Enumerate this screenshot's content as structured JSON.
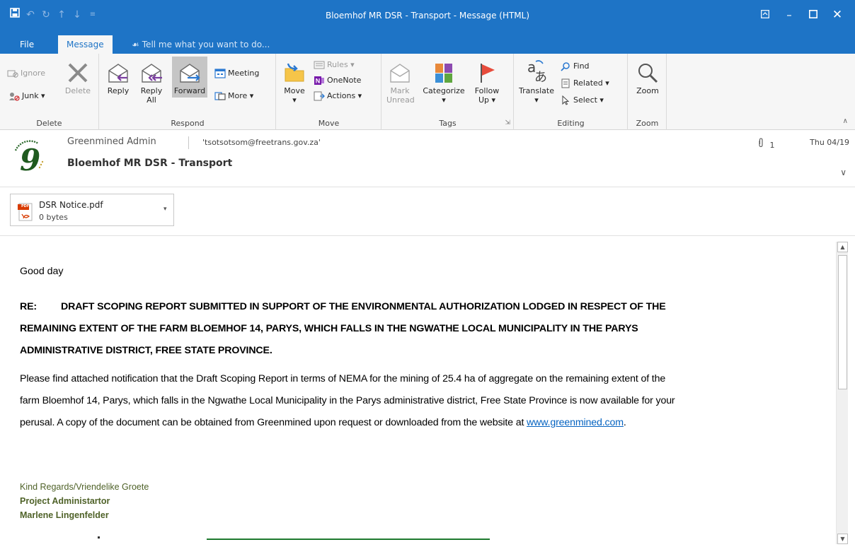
{
  "window": {
    "title": "Bloemhof MR DSR - Transport - Message (HTML)"
  },
  "tabs": {
    "file": "File",
    "message": "Message",
    "tell_me": "Tell me what you want to do..."
  },
  "ribbon": {
    "delete_group": {
      "label": "Delete",
      "ignore": "Ignore",
      "junk": "Junk",
      "delete": "Delete"
    },
    "respond_group": {
      "label": "Respond",
      "reply": "Reply",
      "reply_all_1": "Reply",
      "reply_all_2": "All",
      "forward": "Forward",
      "meeting": "Meeting",
      "more": "More"
    },
    "move_group": {
      "label": "Move",
      "move": "Move",
      "rules": "Rules",
      "onenote": "OneNote",
      "actions": "Actions"
    },
    "tags_group": {
      "label": "Tags",
      "mark_unread_1": "Mark",
      "mark_unread_2": "Unread",
      "categorize": "Categorize",
      "follow_up_1": "Follow",
      "follow_up_2": "Up"
    },
    "editing_group": {
      "label": "Editing",
      "translate": "Translate",
      "find": "Find",
      "related": "Related",
      "select": "Select"
    },
    "zoom_group": {
      "label": "Zoom",
      "zoom": "Zoom"
    }
  },
  "message": {
    "sender": "Greenmined Admin",
    "to": "'tsotsotsom@freetrans.gov.za'",
    "subject": "Bloemhof MR DSR - Transport",
    "attachment_count": "1",
    "date": "Thu 04/19",
    "attachment": {
      "name": "DSR Notice.pdf",
      "size": "0 bytes",
      "type_badge": "PDF"
    }
  },
  "body": {
    "greeting": "Good day",
    "re_label": "RE:",
    "re_line1": "DRAFT SCOPING REPORT SUBMITTED IN SUPPORT OF THE ENVIRONMENTAL AUTHORIZATION LODGED IN RESPECT OF THE",
    "re_line2": "REMAINING EXTENT OF THE FARM BLOEMHOF 14, PARYS, WHICH FALLS IN THE NGWATHE LOCAL MUNICIPALITY IN THE PARYS",
    "re_line3": "ADMINISTRATIVE DISTRICT, FREE STATE PROVINCE.",
    "p_line1": "Please find attached notification that the Draft Scoping Report in terms of NEMA for the mining of 25.4 ha of aggregate on the remaining extent of the",
    "p_line2": "farm Bloemhof 14, Parys, which falls in the Ngwathe Local Municipality in the Parys administrative district, Free State Province is now available for your",
    "p_line3": "perusal. A copy of the document can be obtained from Greenmined upon request or downloaded from the website at",
    "link": "www.greenmined.com",
    "p_end": ".",
    "regards": "Kind Regards/Vriendelike Groete",
    "role": "Project Administartor",
    "name": "Marlene Lingenfelder"
  },
  "colors": {
    "titlebar": "#1e74c6",
    "ribbon": "#f6f6f6",
    "signature": "#4f6228",
    "link": "#0563c1"
  }
}
